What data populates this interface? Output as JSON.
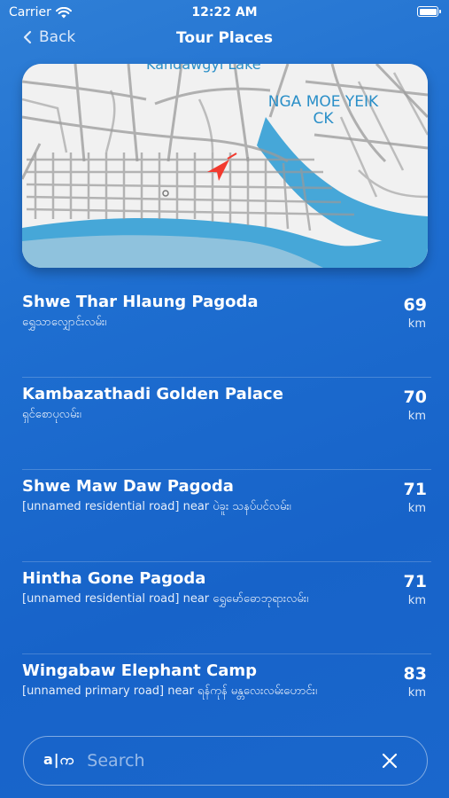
{
  "status_bar": {
    "carrier": "Carrier",
    "time": "12:22 AM"
  },
  "nav": {
    "back_label": "Back",
    "title": "Tour Places"
  },
  "map": {
    "lake_label": "Kandawgyi Lake",
    "area_label": "NGA MOE YEIK CK",
    "accent_color": "#f23a2f",
    "water_color": "#46a7d8"
  },
  "places": [
    {
      "name": "Shwe Thar Hlaung Pagoda",
      "subtitle": "ရွှေသာလျှောင်းလမ်း၊",
      "distance": "69",
      "unit": "km"
    },
    {
      "name": "Kambazathadi Golden Palace",
      "subtitle": "ရှင်စောပုလမ်း၊",
      "distance": "70",
      "unit": "km"
    },
    {
      "name": "Shwe Maw Daw Pagoda",
      "subtitle": "[unnamed residential road] near ပဲခူး သနပ်ပင်လမ်း၊",
      "distance": "71",
      "unit": "km"
    },
    {
      "name": "Hintha Gone Pagoda",
      "subtitle": "[unnamed residential road] near ရွှေမော်ဓောဘုရားလမ်း၊",
      "distance": "71",
      "unit": "km"
    },
    {
      "name": "Wingabaw Elephant Camp",
      "subtitle": "[unnamed primary road] near ရန်ကုန် မန္တလေးလမ်းဟောင်း၊",
      "distance": "83",
      "unit": "km"
    }
  ],
  "search": {
    "lang_toggle": "a|က",
    "placeholder": "Search"
  }
}
